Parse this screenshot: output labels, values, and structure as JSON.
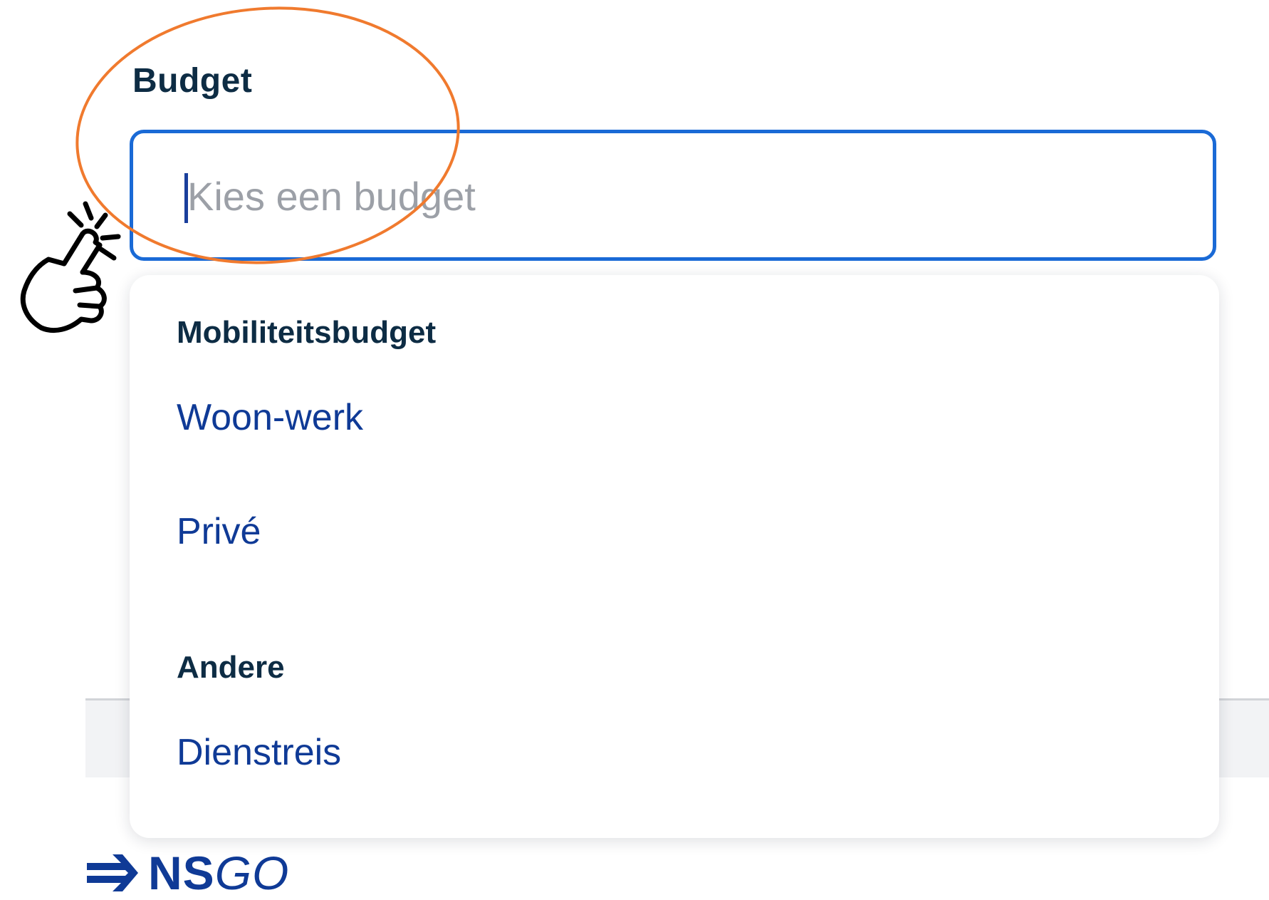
{
  "form": {
    "label": "Budget",
    "input": {
      "value": "",
      "placeholder": "Kies een budget"
    }
  },
  "dropdown": {
    "groups": [
      {
        "heading": "Mobiliteitsbudget",
        "options": [
          "Woon-werk",
          "Privé"
        ]
      },
      {
        "heading": "Andere",
        "options": [
          "Dienstreis"
        ]
      }
    ]
  },
  "logo": {
    "part1": "NS",
    "part2": "GO"
  },
  "colors": {
    "focus_border": "#1a6ad6",
    "heading_text": "#0d2c44",
    "option_text": "#0f3a96",
    "annotation": "#f07a2e"
  },
  "icons": {
    "logo_arrow": "ns-arrow-icon",
    "pointer": "tap-hand-icon"
  }
}
